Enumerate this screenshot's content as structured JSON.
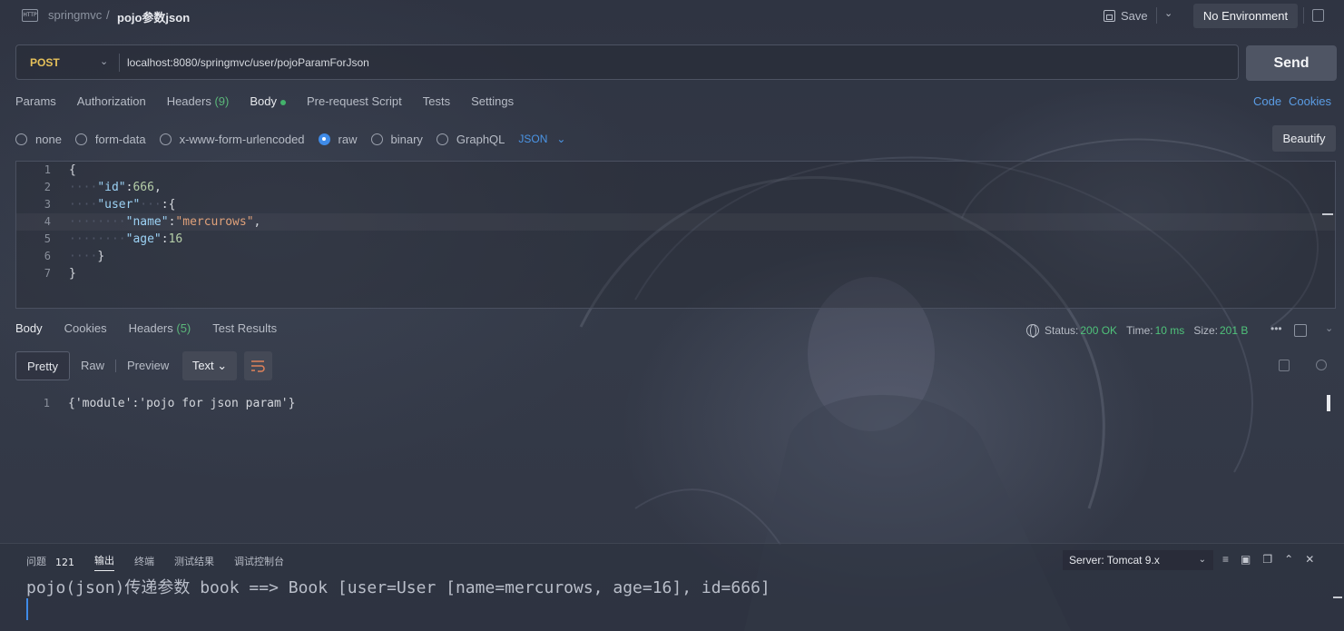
{
  "topbar": {
    "http_icon_text": "HTTP",
    "breadcrumb_parent": "springmvc",
    "breadcrumb_sep": "/",
    "breadcrumb_current": "pojo参数json",
    "save_label": "Save",
    "environment": "No Environment"
  },
  "request": {
    "method": "POST",
    "url": "localhost:8080/springmvc/user/pojoParamForJson",
    "send_label": "Send",
    "tabs": [
      {
        "label": "Params"
      },
      {
        "label": "Authorization"
      },
      {
        "label": "Headers",
        "count": "(9)"
      },
      {
        "label": "Body"
      },
      {
        "label": "Pre-request Script"
      },
      {
        "label": "Tests"
      },
      {
        "label": "Settings"
      }
    ],
    "code_link": "Code",
    "cookies_link": "Cookies",
    "body_types": [
      "none",
      "form-data",
      "x-www-form-urlencoded",
      "raw",
      "binary",
      "GraphQL"
    ],
    "body_type_selected": "raw",
    "language": "JSON",
    "beautify_label": "Beautify",
    "body_lines": [
      {
        "n": "1"
      },
      {
        "n": "2"
      },
      {
        "n": "3"
      },
      {
        "n": "4"
      },
      {
        "n": "5"
      },
      {
        "n": "6"
      },
      {
        "n": "7"
      }
    ],
    "body_tokens": {
      "l1": "{",
      "id_key": "\"id\"",
      "colon": ":",
      "id_val": "666",
      "comma": ",",
      "user_key": "\"user\"",
      "open_brace": "{",
      "name_key": "\"name\"",
      "name_val": "\"mercurows\"",
      "age_key": "\"age\"",
      "age_val": "16",
      "close_inner": "}",
      "close_outer": "}"
    }
  },
  "response": {
    "tabs": [
      {
        "label": "Body"
      },
      {
        "label": "Cookies"
      },
      {
        "label": "Headers",
        "count": "(5)"
      },
      {
        "label": "Test Results"
      }
    ],
    "status_label": "Status:",
    "status_value": "200 OK",
    "time_label": "Time:",
    "time_value": "10 ms",
    "size_label": "Size:",
    "size_value": "201 B",
    "more": "•••",
    "views": [
      "Pretty",
      "Raw",
      "Preview"
    ],
    "format": "Text",
    "line_number": "1",
    "body_text": "{'module':'pojo for json param'}"
  },
  "bottom_panel": {
    "tabs": [
      "问题",
      "输出",
      "终端",
      "测试结果",
      "调试控制台"
    ],
    "problems_count": "121",
    "active_tab": "输出",
    "server_select": "Server: Tomcat 9.x",
    "console_output": "pojo(json)传递参数 book ==> Book [user=User [name=mercurows, age=16], id=666]"
  },
  "colors": {
    "accent_blue": "#3f8be8",
    "method_yellow": "#e6c15a",
    "status_green": "#4fc27a"
  }
}
